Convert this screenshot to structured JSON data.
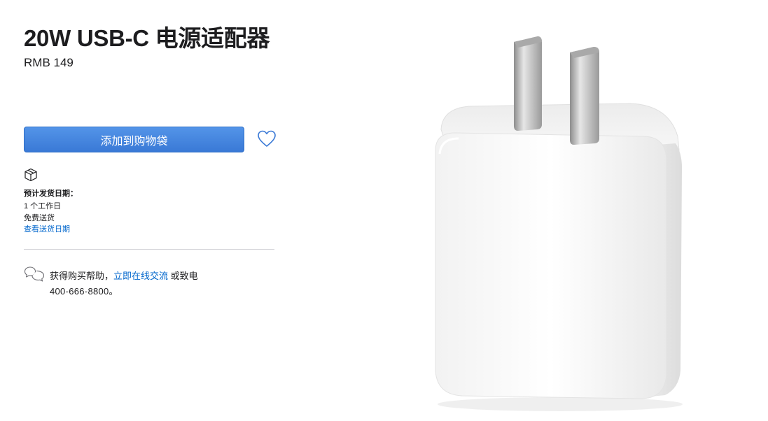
{
  "product": {
    "title": "20W USB-C 电源适配器",
    "price": "RMB 149"
  },
  "actions": {
    "add_to_bag_label": "添加到购物袋",
    "favorite_icon": "heart-icon"
  },
  "shipping": {
    "icon": "box-icon",
    "label": "预计发货日期：",
    "days": "1 个工作日",
    "free": "免费送货",
    "link": "查看送货日期"
  },
  "help": {
    "icon": "chat-bubbles-icon",
    "prefix": "获得购买帮助，",
    "link": "立即在线交流",
    "suffix": " 或致电",
    "phone": "400-666-8800。"
  },
  "colors": {
    "button_blue": "#3a79d6",
    "link_blue": "#0066cc",
    "heading": "#1d1d1f"
  }
}
